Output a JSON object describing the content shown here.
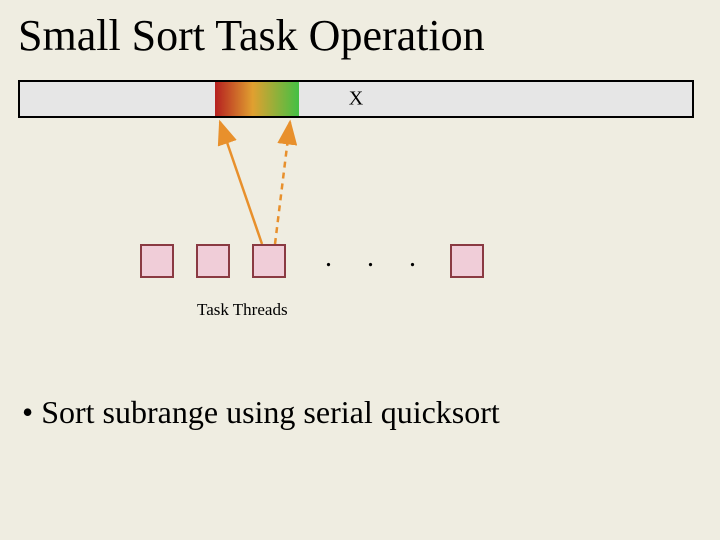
{
  "title": "Small Sort Task Operation",
  "array_label": "X",
  "threads_label": "Task Threads",
  "dots": ". . .",
  "bullet_text": "• Sort subrange using serial quicksort",
  "chart_data": {
    "type": "diagram",
    "title": "Small Sort Task Operation",
    "elements": {
      "array": {
        "label": "X",
        "highlighted_subrange": "middle-left gradient red→green"
      },
      "task_threads": {
        "count_shown": 4,
        "ellipsis": true,
        "label": "Task Threads"
      },
      "arrows": [
        {
          "from": "thread 3",
          "to": "subrange start",
          "style": "solid orange"
        },
        {
          "from": "thread 3",
          "to": "subrange end",
          "style": "dashed orange"
        }
      ]
    },
    "annotations": [
      "Sort subrange using serial quicksort"
    ]
  }
}
